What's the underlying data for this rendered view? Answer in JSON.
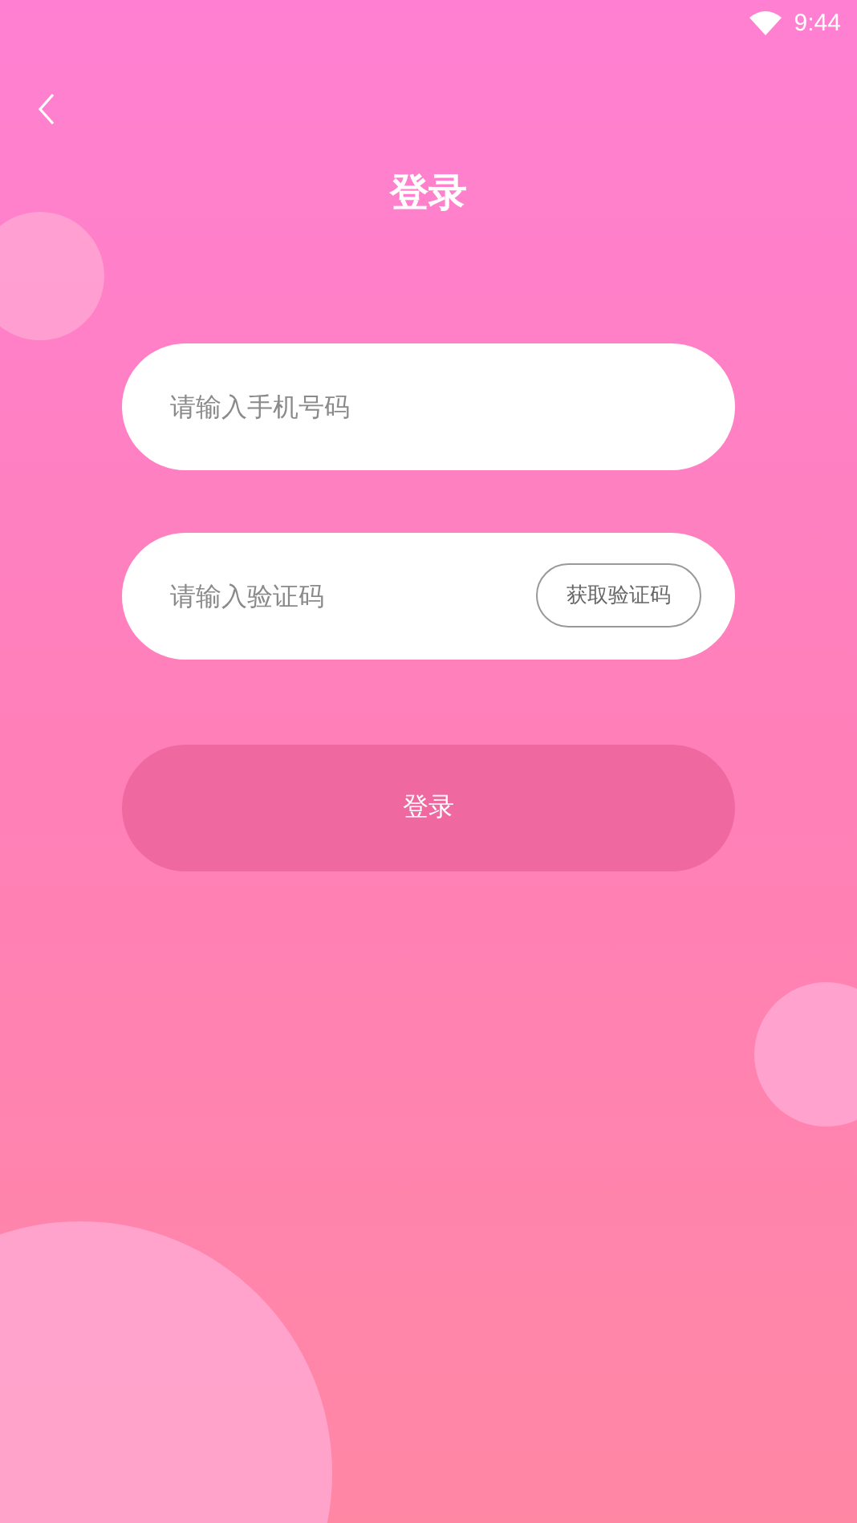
{
  "status_bar": {
    "time": "9:44"
  },
  "title": "登录",
  "phone_field": {
    "placeholder": "请输入手机号码"
  },
  "code_field": {
    "placeholder": "请输入验证码",
    "button": "获取验证码"
  },
  "login_button": "登录"
}
